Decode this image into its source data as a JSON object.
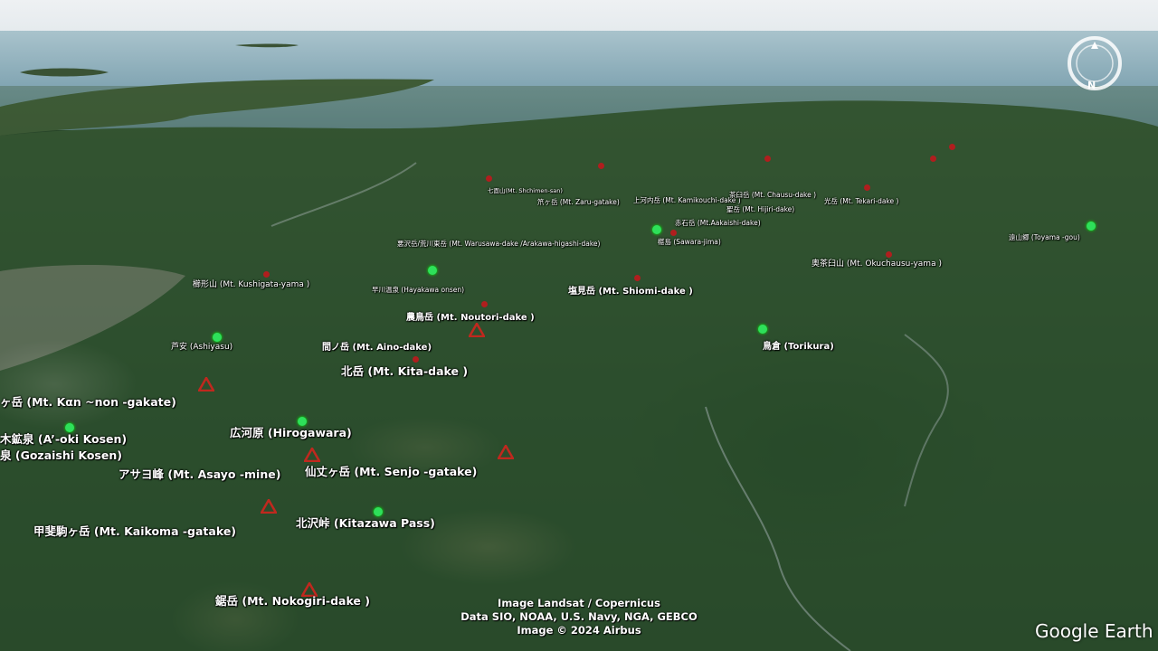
{
  "attribution": {
    "line1": "Image Landsat / Copernicus",
    "line2": "Data SIO, NOAA, U.S. Navy, NGA, GEBCO",
    "line3": "Image © 2024 Airbus"
  },
  "logo": "Google Earth",
  "labels": {
    "kannon": "ヶ岳 (Mt. Kαn ~non -gakate)",
    "aoki": "木鉱泉 (A’-oki Kosen)",
    "gozaishi": "泉 (Gozaishi Kosen)",
    "hirogawara": "広河原 (Hirogawara)",
    "asayo": "アサヨ峰 (Mt. Asayo -mine)",
    "senjo": "仙丈ヶ岳 (Mt. Senjo -gatake)",
    "kaikoma": "甲斐駒ヶ岳 (Mt. Kaikoma -gatake)",
    "kitazawa": "北沢峠 (Kitazawa Pass)",
    "nokogiri": "鋸岳 (Mt. Nokogiri-dake )",
    "kita": "北岳 (Mt. Kita-dake )",
    "aino": "間ノ岳 (Mt. Aino-dake)",
    "ashiyasu": "芦安 (Ashiyasu)",
    "noutori": "農鳥岳 (Mt. Noutori-dake )",
    "shiomi": "塩見岳 (Mt. Shiomi-dake )",
    "torikura": "鳥倉 (Torikura)",
    "kushigata": "櫛形山 (Mt. Kushigata-yama )",
    "hayakawa": "早川温泉 (Hayakawa onsen)",
    "warusawa": "悪沢岳/荒川東岳 (Mt. Warusawa-dake /Arakawa-higashi-dake)",
    "sawarajima": "椹島 (Sawara-jima)",
    "akaishi": "赤石岳 (Mt.Aakaishi-dake)",
    "okuchausu": "奥茶臼山 (Mt. Okuchausu-yama )",
    "toyamagou": "遠山郷 (Toyama -gou)",
    "shichimen": "七面山(Mt. Shchimen-san)",
    "zaru": "笊ヶ岳 (Mt. Zaru-gatake)",
    "kamikouchi": "上河内岳 (Mt. Kamikouchi-dake )",
    "chausu": "茶臼岳 (Mt. Chausu-dake )",
    "hijiri": "聖岳 (Mt. Hijiri-dake)",
    "tekari": "光岳 (Mt. Tekari-dake )"
  },
  "colors": {
    "peak_marker": "#c0281e",
    "place_marker": "#2ee05a",
    "label_text": "#ffffff"
  },
  "icons": {
    "peak": "red-triangle-icon",
    "place": "green-dot-icon",
    "compass": "compass-icon"
  }
}
